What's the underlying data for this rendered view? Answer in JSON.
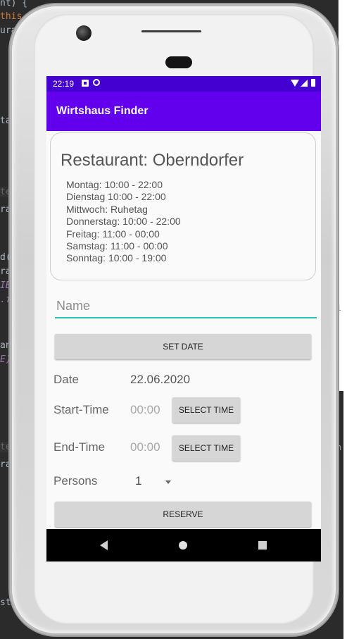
{
  "background_code": {
    "lines": [
      "nt) {",
      "this.",
      "urar",
      "tau",
      "text",
      "ran",
      "d(R",
      "ran",
      "IBL",
      ".fr",
      "ant",
      "E);",
      "text",
      "ran",
      "st."
    ],
    "right_fragments": [
      "i",
      "n"
    ]
  },
  "status_bar": {
    "time": "22:19",
    "icons": [
      "notification-icon",
      "sync-icon",
      "wifi-icon",
      "signal-icon",
      "battery-icon"
    ],
    "color": "#4400d0"
  },
  "app_bar": {
    "title": "Wirtshaus Finder",
    "color": "#6200ee"
  },
  "restaurant": {
    "title": "Restaurant: Oberndorfer",
    "hours": [
      "Montag: 10:00 - 22:00",
      "Dienstag 10:00 - 22:00",
      "Mittwoch: Ruhetag",
      "Donnerstag: 10:00 - 22:00",
      "Freitag: 11:00 - 00:00",
      "Samstag: 11:00 - 00:00",
      "Sonntag: 10:00 - 19:00"
    ]
  },
  "form": {
    "name_placeholder": "Name",
    "name_value": "",
    "accent_color": "#26c6b0",
    "set_date_label": "SET DATE",
    "date_label": "Date",
    "date_value": "22.06.2020",
    "start_label": "Start-Time",
    "start_value": "00:00",
    "end_label": "End-Time",
    "end_value": "00:00",
    "select_time_label": "SELECT TIME",
    "persons_label": "Persons",
    "persons_value": "1",
    "reserve_label": "RESERVE"
  },
  "nav_bar": {
    "icons": [
      "back-icon",
      "home-icon",
      "recents-icon"
    ]
  }
}
